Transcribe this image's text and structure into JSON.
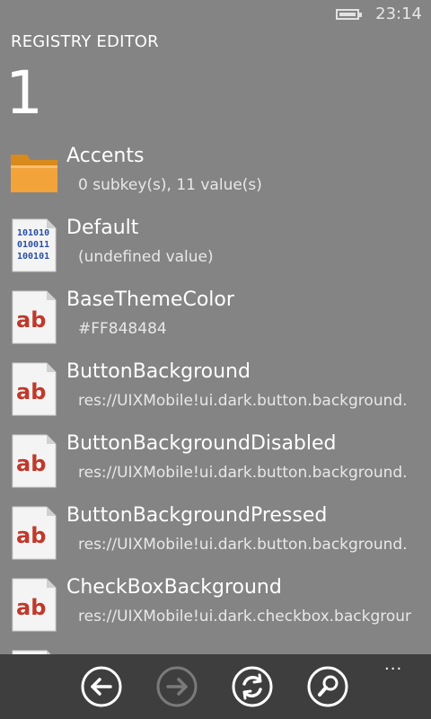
{
  "status_bar": {
    "time": "23:14"
  },
  "header": {
    "app_title": "REGISTRY EDITOR",
    "page_title": "1"
  },
  "list": {
    "items": [
      {
        "name": "Accents",
        "detail": "0 subkey(s), 11 value(s)",
        "icon": "folder-icon"
      },
      {
        "name": "Default",
        "detail": "(undefined value)",
        "icon": "binary-file-icon"
      },
      {
        "name": "BaseThemeColor",
        "detail": "#FF848484",
        "icon": "string-value-icon"
      },
      {
        "name": "ButtonBackground",
        "detail": "res://UIXMobile!ui.dark.button.background.",
        "icon": "string-value-icon"
      },
      {
        "name": "ButtonBackgroundDisabled",
        "detail": "res://UIXMobile!ui.dark.button.background.",
        "icon": "string-value-icon"
      },
      {
        "name": "ButtonBackgroundPressed",
        "detail": "res://UIXMobile!ui.dark.button.background.",
        "icon": "string-value-icon"
      },
      {
        "name": "CheckBoxBackground",
        "detail": "res://UIXMobile!ui.dark.checkbox.backgrour",
        "icon": "string-value-icon"
      }
    ]
  },
  "icons": {
    "binary_text": "101010",
    "string_text": "ab"
  },
  "app_bar": {
    "buttons": [
      "back-icon",
      "forward-icon",
      "refresh-icon",
      "search-icon"
    ],
    "more": "..."
  },
  "colors": {
    "background": "#848484",
    "app_bar": "#3e3e3e",
    "folder": "#f0a030",
    "string_icon_text": "#c0392b"
  }
}
